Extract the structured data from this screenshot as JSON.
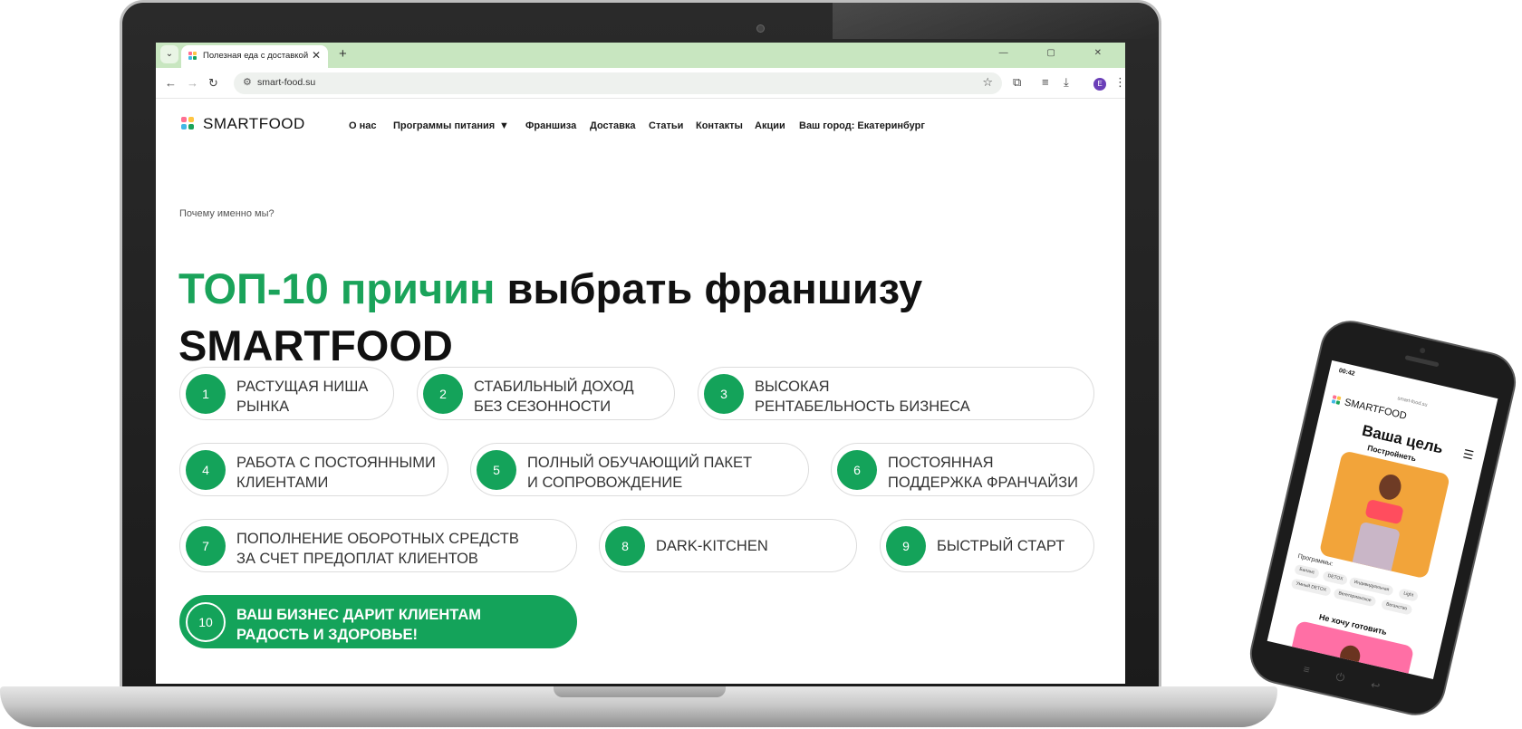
{
  "browser": {
    "tab_title": "Полезная еда с доставкой в Ек",
    "tab_close": "✕",
    "new_tab": "+",
    "tab_menu": "⌄",
    "window_controls": "—  ▢  ✕",
    "url": "smart-food.su",
    "profile_initial": "E"
  },
  "site": {
    "logo": "SMARTFOOD",
    "nav": [
      "О нас",
      "Программы питания",
      "▼",
      "Франшиза",
      "Доставка",
      "Статьи",
      "Контакты",
      "Акции",
      "Ваш город: Екатеринбург"
    ],
    "breadcrumb": "Почему именно мы?",
    "headline_accent": "ТОП-10 причин",
    "headline_rest": " выбрать франшизу",
    "headline_line2": "SMARTFOOD",
    "reasons": [
      {
        "num": "1",
        "text": "РАСТУЩАЯ НИША\nРЫНКА"
      },
      {
        "num": "2",
        "text": "СТАБИЛЬНЫЙ ДОХОД\nБЕЗ СЕЗОННОСТИ"
      },
      {
        "num": "3",
        "text": "ВЫСОКАЯ\nРЕНТАБЕЛЬНОСТЬ БИЗНЕСА"
      },
      {
        "num": "4",
        "text": "РАБОТА С ПОСТОЯННЫМИ\nКЛИЕНТАМИ"
      },
      {
        "num": "5",
        "text": "ПОЛНЫЙ ОБУЧАЮЩИЙ ПАКЕТ\nИ СОПРОВОЖДЕНИЕ"
      },
      {
        "num": "6",
        "text": "ПОСТОЯННАЯ\nПОДДЕРЖКА ФРАНЧАЙЗИ"
      },
      {
        "num": "7",
        "text": "ПОПОЛНЕНИЕ ОБОРОТНЫХ СРЕДСТВ\nЗА СЧЕТ ПРЕДОПЛАТ КЛИЕНТОВ"
      },
      {
        "num": "8",
        "text": "DARK-KITCHEN"
      },
      {
        "num": "9",
        "text": "БЫСТРЫЙ СТАРТ"
      },
      {
        "num": "10",
        "text": "ВАШ БИЗНЕС ДАРИТ КЛИЕНТАМ\nРАДОСТЬ И ЗДОРОВЬЕ!"
      }
    ]
  },
  "phone": {
    "time": "00:42",
    "url": "smart-food.su",
    "logo": "SMARTFOOD",
    "headline": "Ваша цель",
    "subtitle": "Постройнеть",
    "programs_label": "Программы:",
    "chips": [
      "Баланс",
      "DETOX",
      "Индивидуальная",
      "Light",
      "Умный DETOX",
      "Вегетарианское",
      "Веганство"
    ],
    "section2": "Не хочу готовить"
  },
  "colors": {
    "accent_green": "#14a35a",
    "tab_bar": "#c8e6c0"
  }
}
